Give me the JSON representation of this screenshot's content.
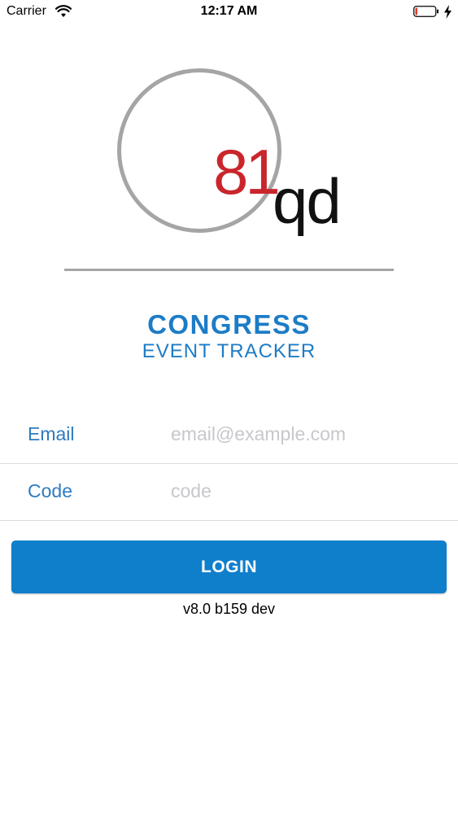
{
  "status_bar": {
    "carrier": "Carrier",
    "time": "12:17 AM",
    "icons": [
      "wifi-icon",
      "battery-low-icon",
      "charging-bolt-icon"
    ]
  },
  "logo": {
    "number": "81",
    "letters": "qd",
    "number_color": "#c9262c",
    "ring_color": "#a5a5a5"
  },
  "app": {
    "title": "CONGRESS",
    "subtitle": "EVENT TRACKER",
    "accent_color": "#1c7cc6"
  },
  "form": {
    "email": {
      "label": "Email",
      "placeholder": "email@example.com",
      "value": ""
    },
    "code": {
      "label": "Code",
      "placeholder": "code",
      "value": ""
    }
  },
  "login_button": {
    "label": "LOGIN",
    "color": "#0f7fcc"
  },
  "version": "v8.0 b159 dev"
}
